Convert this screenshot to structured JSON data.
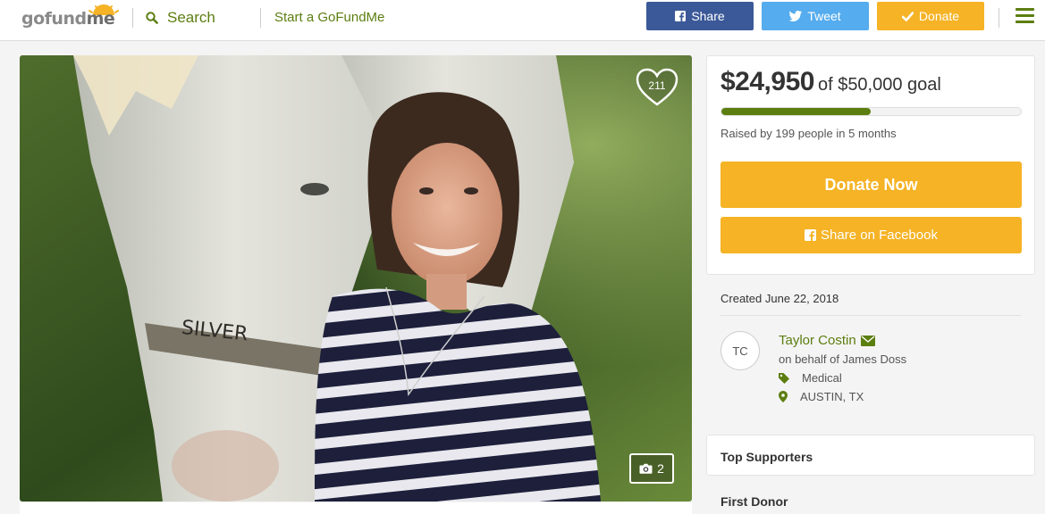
{
  "header": {
    "logo_text_a": "gofund",
    "logo_text_b": "me",
    "search_label": "Search",
    "start_label": "Start a GoFundMe",
    "share_label": "Share",
    "tweet_label": "Tweet",
    "donate_label": "Donate"
  },
  "photo": {
    "heart_count": "211",
    "photo_count": "2",
    "halter_text": "SILVER"
  },
  "campaign": {
    "amount": "$24,950",
    "goal_text": "of $50,000 goal",
    "progress_fraction": 0.499,
    "raised_text": "Raised by 199 people in 5 months",
    "donate_now_label": "Donate Now",
    "share_fb_label": "Share on Facebook",
    "created_text": "Created June 22, 2018",
    "organizer_initials": "TC",
    "organizer_name": "Taylor Costin",
    "on_behalf": "on behalf of James Doss",
    "category": "Medical",
    "location": "AUSTIN, TX"
  },
  "supporters": {
    "title": "Top Supporters",
    "first_donor": "First Donor"
  },
  "colors": {
    "brand_green": "#5c7e10",
    "donate_orange": "#f5b325",
    "facebook_blue": "#3b5998",
    "twitter_blue": "#55acee"
  },
  "icons": [
    "search-icon",
    "facebook-icon",
    "twitter-icon",
    "check-icon",
    "menu-icon",
    "heart-icon",
    "camera-icon",
    "envelope-icon",
    "tag-icon",
    "map-pin-icon"
  ]
}
